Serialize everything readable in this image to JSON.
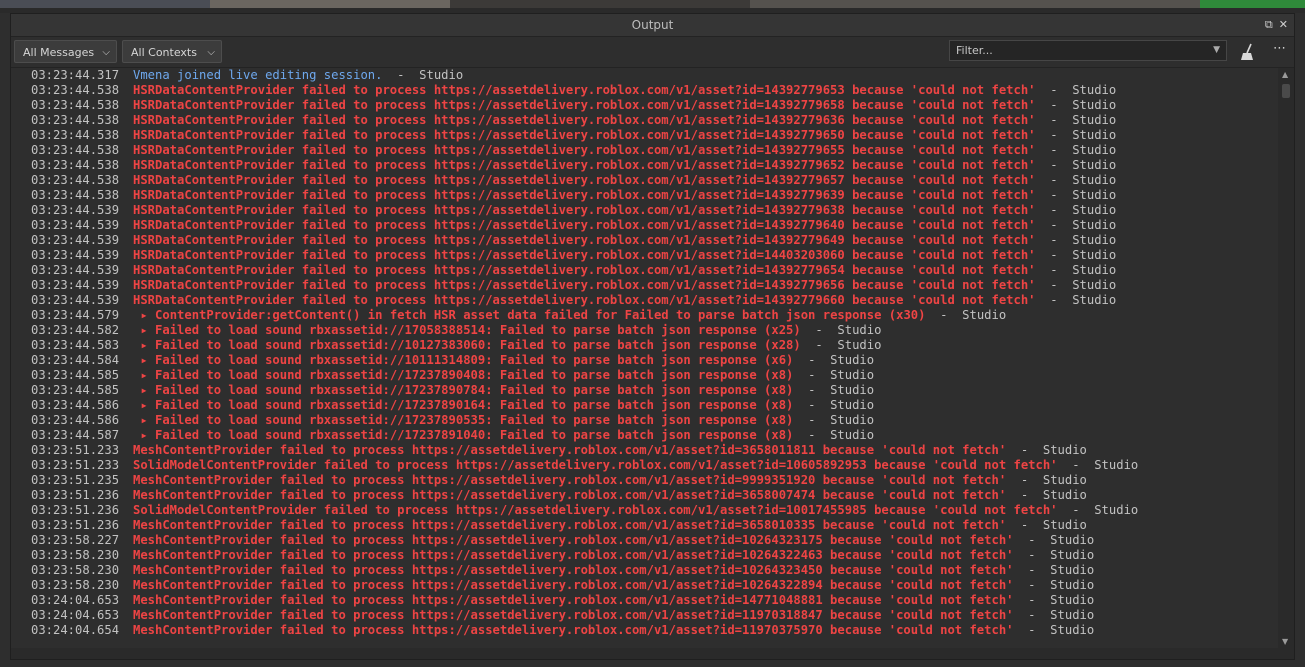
{
  "window": {
    "title": "Output"
  },
  "toolbar": {
    "messages_filter": "All Messages",
    "contexts_filter": "All Contexts",
    "filter_placeholder": "Filter..."
  },
  "colors": {
    "info": "#6ea8ee",
    "error": "#ee4444",
    "text": "#c2c2c2"
  },
  "log": [
    {
      "time": "03:23:44.317",
      "type": "info",
      "text": "Vmena joined live editing session.",
      "source": "  -  Studio"
    },
    {
      "time": "03:23:44.538",
      "type": "error",
      "text": "HSRDataContentProvider failed to process https://assetdelivery.roblox.com/v1/asset?id=14392779653 because 'could not fetch'",
      "source": "  -  Studio"
    },
    {
      "time": "03:23:44.538",
      "type": "error",
      "text": "HSRDataContentProvider failed to process https://assetdelivery.roblox.com/v1/asset?id=14392779658 because 'could not fetch'",
      "source": "  -  Studio"
    },
    {
      "time": "03:23:44.538",
      "type": "error",
      "text": "HSRDataContentProvider failed to process https://assetdelivery.roblox.com/v1/asset?id=14392779636 because 'could not fetch'",
      "source": "  -  Studio"
    },
    {
      "time": "03:23:44.538",
      "type": "error",
      "text": "HSRDataContentProvider failed to process https://assetdelivery.roblox.com/v1/asset?id=14392779650 because 'could not fetch'",
      "source": "  -  Studio"
    },
    {
      "time": "03:23:44.538",
      "type": "error",
      "text": "HSRDataContentProvider failed to process https://assetdelivery.roblox.com/v1/asset?id=14392779655 because 'could not fetch'",
      "source": "  -  Studio"
    },
    {
      "time": "03:23:44.538",
      "type": "error",
      "text": "HSRDataContentProvider failed to process https://assetdelivery.roblox.com/v1/asset?id=14392779652 because 'could not fetch'",
      "source": "  -  Studio"
    },
    {
      "time": "03:23:44.538",
      "type": "error",
      "text": "HSRDataContentProvider failed to process https://assetdelivery.roblox.com/v1/asset?id=14392779657 because 'could not fetch'",
      "source": "  -  Studio"
    },
    {
      "time": "03:23:44.538",
      "type": "error",
      "text": "HSRDataContentProvider failed to process https://assetdelivery.roblox.com/v1/asset?id=14392779639 because 'could not fetch'",
      "source": "  -  Studio"
    },
    {
      "time": "03:23:44.539",
      "type": "error",
      "text": "HSRDataContentProvider failed to process https://assetdelivery.roblox.com/v1/asset?id=14392779638 because 'could not fetch'",
      "source": "  -  Studio"
    },
    {
      "time": "03:23:44.539",
      "type": "error",
      "text": "HSRDataContentProvider failed to process https://assetdelivery.roblox.com/v1/asset?id=14392779640 because 'could not fetch'",
      "source": "  -  Studio"
    },
    {
      "time": "03:23:44.539",
      "type": "error",
      "text": "HSRDataContentProvider failed to process https://assetdelivery.roblox.com/v1/asset?id=14392779649 because 'could not fetch'",
      "source": "  -  Studio"
    },
    {
      "time": "03:23:44.539",
      "type": "error",
      "text": "HSRDataContentProvider failed to process https://assetdelivery.roblox.com/v1/asset?id=14403203060 because 'could not fetch'",
      "source": "  -  Studio"
    },
    {
      "time": "03:23:44.539",
      "type": "error",
      "text": "HSRDataContentProvider failed to process https://assetdelivery.roblox.com/v1/asset?id=14392779654 because 'could not fetch'",
      "source": "  -  Studio"
    },
    {
      "time": "03:23:44.539",
      "type": "error",
      "text": "HSRDataContentProvider failed to process https://assetdelivery.roblox.com/v1/asset?id=14392779656 because 'could not fetch'",
      "source": "  -  Studio"
    },
    {
      "time": "03:23:44.539",
      "type": "error",
      "text": "HSRDataContentProvider failed to process https://assetdelivery.roblox.com/v1/asset?id=14392779660 because 'could not fetch'",
      "source": "  -  Studio"
    },
    {
      "time": "03:23:44.579",
      "type": "error",
      "arrow": true,
      "text": "ContentProvider:getContent() in fetch HSR asset data failed for Failed to parse batch json response (x30)",
      "source": "  -  Studio"
    },
    {
      "time": "03:23:44.582",
      "type": "error",
      "arrow": true,
      "text": "Failed to load sound rbxassetid://17058388514: Failed to parse batch json response (x25)",
      "source": "  -  Studio"
    },
    {
      "time": "03:23:44.583",
      "type": "error",
      "arrow": true,
      "text": "Failed to load sound rbxassetid://10127383060: Failed to parse batch json response (x28)",
      "source": "  -  Studio"
    },
    {
      "time": "03:23:44.584",
      "type": "error",
      "arrow": true,
      "text": "Failed to load sound rbxassetid://10111314809: Failed to parse batch json response (x6)",
      "source": "  -  Studio"
    },
    {
      "time": "03:23:44.585",
      "type": "error",
      "arrow": true,
      "text": "Failed to load sound rbxassetid://17237890408: Failed to parse batch json response (x8)",
      "source": "  -  Studio"
    },
    {
      "time": "03:23:44.585",
      "type": "error",
      "arrow": true,
      "text": "Failed to load sound rbxassetid://17237890784: Failed to parse batch json response (x8)",
      "source": "  -  Studio"
    },
    {
      "time": "03:23:44.586",
      "type": "error",
      "arrow": true,
      "text": "Failed to load sound rbxassetid://17237890164: Failed to parse batch json response (x8)",
      "source": "  -  Studio"
    },
    {
      "time": "03:23:44.586",
      "type": "error",
      "arrow": true,
      "text": "Failed to load sound rbxassetid://17237890535: Failed to parse batch json response (x8)",
      "source": "  -  Studio"
    },
    {
      "time": "03:23:44.587",
      "type": "error",
      "arrow": true,
      "text": "Failed to load sound rbxassetid://17237891040: Failed to parse batch json response (x8)",
      "source": "  -  Studio"
    },
    {
      "time": "03:23:51.233",
      "type": "error",
      "text": "MeshContentProvider failed to process https://assetdelivery.roblox.com/v1/asset?id=3658011811 because 'could not fetch'",
      "source": "  -  Studio"
    },
    {
      "time": "03:23:51.233",
      "type": "error",
      "text": "SolidModelContentProvider failed to process https://assetdelivery.roblox.com/v1/asset?id=10605892953 because 'could not fetch'",
      "source": "  -  Studio"
    },
    {
      "time": "03:23:51.235",
      "type": "error",
      "text": "MeshContentProvider failed to process https://assetdelivery.roblox.com/v1/asset?id=9999351920 because 'could not fetch'",
      "source": "  -  Studio"
    },
    {
      "time": "03:23:51.236",
      "type": "error",
      "text": "MeshContentProvider failed to process https://assetdelivery.roblox.com/v1/asset?id=3658007474 because 'could not fetch'",
      "source": "  -  Studio"
    },
    {
      "time": "03:23:51.236",
      "type": "error",
      "text": "SolidModelContentProvider failed to process https://assetdelivery.roblox.com/v1/asset?id=10017455985 because 'could not fetch'",
      "source": "  -  Studio"
    },
    {
      "time": "03:23:51.236",
      "type": "error",
      "text": "MeshContentProvider failed to process https://assetdelivery.roblox.com/v1/asset?id=3658010335 because 'could not fetch'",
      "source": "  -  Studio"
    },
    {
      "time": "03:23:58.227",
      "type": "error",
      "text": "MeshContentProvider failed to process https://assetdelivery.roblox.com/v1/asset?id=10264323175 because 'could not fetch'",
      "source": "  -  Studio"
    },
    {
      "time": "03:23:58.230",
      "type": "error",
      "text": "MeshContentProvider failed to process https://assetdelivery.roblox.com/v1/asset?id=10264322463 because 'could not fetch'",
      "source": "  -  Studio"
    },
    {
      "time": "03:23:58.230",
      "type": "error",
      "text": "MeshContentProvider failed to process https://assetdelivery.roblox.com/v1/asset?id=10264323450 because 'could not fetch'",
      "source": "  -  Studio"
    },
    {
      "time": "03:23:58.230",
      "type": "error",
      "text": "MeshContentProvider failed to process https://assetdelivery.roblox.com/v1/asset?id=10264322894 because 'could not fetch'",
      "source": "  -  Studio"
    },
    {
      "time": "03:24:04.653",
      "type": "error",
      "text": "MeshContentProvider failed to process https://assetdelivery.roblox.com/v1/asset?id=14771048881 because 'could not fetch'",
      "source": "  -  Studio"
    },
    {
      "time": "03:24:04.653",
      "type": "error",
      "text": "MeshContentProvider failed to process https://assetdelivery.roblox.com/v1/asset?id=11970318847 because 'could not fetch'",
      "source": "  -  Studio"
    },
    {
      "time": "03:24:04.654",
      "type": "error",
      "text": "MeshContentProvider failed to process https://assetdelivery.roblox.com/v1/asset?id=11970375970 because 'could not fetch'",
      "source": "  -  Studio"
    }
  ]
}
